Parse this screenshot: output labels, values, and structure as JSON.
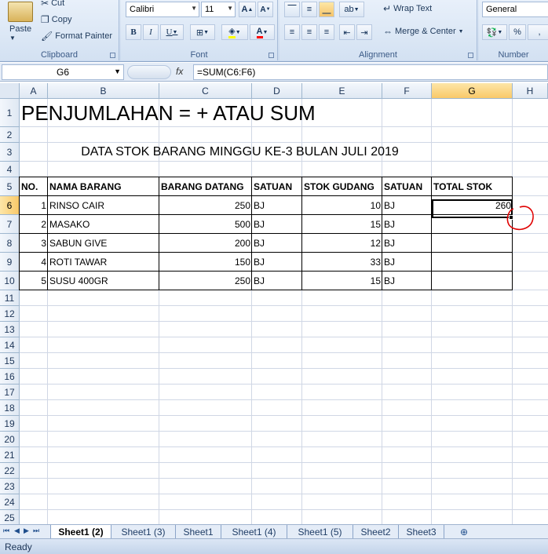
{
  "ribbon": {
    "clipboard": {
      "paste": "Paste",
      "cut": "Cut",
      "copy": "Copy",
      "format_painter": "Format Painter",
      "title": "Clipboard"
    },
    "font": {
      "name": "Calibri",
      "size": "11",
      "title": "Font"
    },
    "alignment": {
      "wrap_text": "Wrap Text",
      "merge_center": "Merge & Center",
      "title": "Alignment"
    },
    "number": {
      "format": "General",
      "percent": "%",
      "title": "Number"
    }
  },
  "formula_bar": {
    "name_box": "G6",
    "fx": "fx",
    "formula": "=SUM(C6:F6)"
  },
  "columns": [
    "A",
    "B",
    "C",
    "D",
    "E",
    "F",
    "G",
    "H"
  ],
  "rows": [
    "1",
    "2",
    "3",
    "4",
    "5",
    "6",
    "7",
    "8",
    "9",
    "10",
    "11",
    "12",
    "13",
    "14",
    "15",
    "16",
    "17",
    "18",
    "19",
    "20",
    "21",
    "22",
    "23",
    "24",
    "25"
  ],
  "sheet": {
    "title": "PENJUMLAHAN = + ATAU SUM",
    "subtitle": "DATA STOK BARANG MINGGU KE-3 BULAN JULI 2019",
    "headers": [
      "NO.",
      "NAMA BARANG",
      "BARANG DATANG",
      "SATUAN",
      "STOK GUDANG",
      "SATUAN",
      "TOTAL STOK"
    ],
    "data": [
      [
        "1",
        "RINSO CAIR",
        "250",
        "BJ",
        "10",
        "BJ",
        "260"
      ],
      [
        "2",
        "MASAKO",
        "500",
        "BJ",
        "15",
        "BJ",
        ""
      ],
      [
        "3",
        "SABUN GIVE",
        "200",
        "BJ",
        "12",
        "BJ",
        ""
      ],
      [
        "4",
        "ROTI TAWAR",
        "150",
        "BJ",
        "33",
        "BJ",
        ""
      ],
      [
        "5",
        "SUSU 400GR",
        "250",
        "BJ",
        "15",
        "BJ",
        ""
      ]
    ]
  },
  "tabs": [
    "Sheet1 (2)",
    "Sheet1 (3)",
    "Sheet1",
    "Sheet1 (4)",
    "Sheet1 (5)",
    "Sheet2",
    "Sheet3"
  ],
  "active_tab": "Sheet1 (2)",
  "status": "Ready"
}
